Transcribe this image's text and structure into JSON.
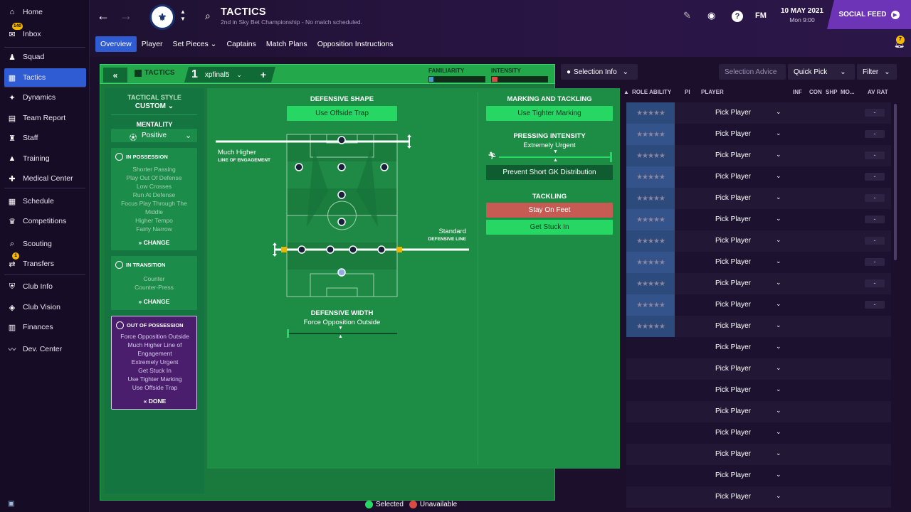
{
  "colors": {
    "accent": "#2f5bd3",
    "tactic_green": "#23a84c",
    "selected": "#27d764",
    "unavailable": "#d94b43",
    "social": "#6d34b8"
  },
  "sidebar": {
    "items": [
      {
        "label": "Home",
        "icon": "home-icon"
      },
      {
        "label": "Inbox",
        "icon": "inbox-icon",
        "badge": "140"
      },
      {
        "label": "Squad",
        "icon": "squad-icon"
      },
      {
        "label": "Tactics",
        "icon": "tactics-icon",
        "active": true
      },
      {
        "label": "Dynamics",
        "icon": "dynamics-icon"
      },
      {
        "label": "Team Report",
        "icon": "report-icon"
      },
      {
        "label": "Staff",
        "icon": "staff-icon"
      },
      {
        "label": "Training",
        "icon": "training-icon"
      },
      {
        "label": "Medical Center",
        "icon": "medical-icon"
      },
      {
        "label": "Schedule",
        "icon": "calendar-icon"
      },
      {
        "label": "Competitions",
        "icon": "trophy-icon"
      },
      {
        "label": "Scouting",
        "icon": "scouting-icon"
      },
      {
        "label": "Transfers",
        "icon": "transfers-icon",
        "badge": "1"
      },
      {
        "label": "Club Info",
        "icon": "shield-icon"
      },
      {
        "label": "Club Vision",
        "icon": "vision-icon"
      },
      {
        "label": "Finances",
        "icon": "finances-icon"
      },
      {
        "label": "Dev. Center",
        "icon": "dev-center-icon"
      }
    ]
  },
  "header": {
    "title": "TACTICS",
    "subtitle": "2nd in Sky Bet Championship - No match scheduled.",
    "date": "10 MAY 2021",
    "time": "Mon 9:00",
    "fm_logo": "FM",
    "social_feed": "SOCIAL FEED",
    "notification_count": "7",
    "subtabs": [
      "Overview",
      "Player",
      "Set Pieces",
      "Captains",
      "Match Plans",
      "Opposition Instructions"
    ]
  },
  "right_panel": {
    "selection_info": "Selection Info",
    "selection_advice": "Selection Advice",
    "quick_pick": "Quick Pick",
    "filter": "Filter",
    "columns": [
      "ROLE ABILITY",
      "PI",
      "PLAYER",
      "INF",
      "CON",
      "SHP",
      "MO...",
      "AV RAT"
    ],
    "pick_label": "Pick Player",
    "dash": "-",
    "row_count": 19
  },
  "tactic_bar": {
    "label": "TACTICS",
    "slot": "1",
    "name": "xpfinal5",
    "familiarity_label": "FAMILIARITY",
    "intensity_label": "INTENSITY",
    "familiarity": 0.08,
    "intensity": 0.1
  },
  "left_col": {
    "tactical_style_label": "TACTICAL STYLE",
    "tactical_style": "CUSTOM",
    "mentality_label": "MENTALITY",
    "mentality": "Positive",
    "in_possession": {
      "title": "IN POSSESSION",
      "lines": [
        "Shorter Passing",
        "Play Out Of Defense",
        "Low Crosses",
        "Run At Defense",
        "Focus Play Through The",
        "Middle",
        "Higher Tempo",
        "Fairly Narrow"
      ],
      "action": "CHANGE"
    },
    "in_transition": {
      "title": "IN TRANSITION",
      "lines": [
        "Counter",
        "Counter-Press"
      ],
      "action": "CHANGE"
    },
    "out_of_possession": {
      "title": "OUT OF POSSESSION",
      "lines": [
        "Force Opposition Outside",
        "Much Higher Line of",
        "Engagement",
        "Extremely Urgent",
        "Get Stuck In",
        "Use Tighter Marking",
        "Use Offside Trap"
      ],
      "action": "DONE"
    }
  },
  "defensive_shape": {
    "title": "DEFENSIVE SHAPE",
    "offside_button": "Use Offside Trap",
    "engagement_value": "Much Higher",
    "engagement_label": "LINE OF ENGAGEMENT",
    "defline_value": "Standard",
    "defline_label": "DEFENSIVE LINE",
    "width_title": "DEFENSIVE WIDTH",
    "width_value": "Force Opposition Outside"
  },
  "marking": {
    "title": "MARKING AND TACKLING",
    "tighter_button": "Use Tighter Marking",
    "pressing_title": "PRESSING INTENSITY",
    "pressing_value": "Extremely Urgent",
    "prevent_button": "Prevent Short GK Distribution",
    "tackling_title": "TACKLING",
    "stay_button": "Stay On Feet",
    "stuck_button": "Get Stuck In"
  },
  "legend": {
    "selected": "Selected",
    "unavailable": "Unavailable"
  }
}
